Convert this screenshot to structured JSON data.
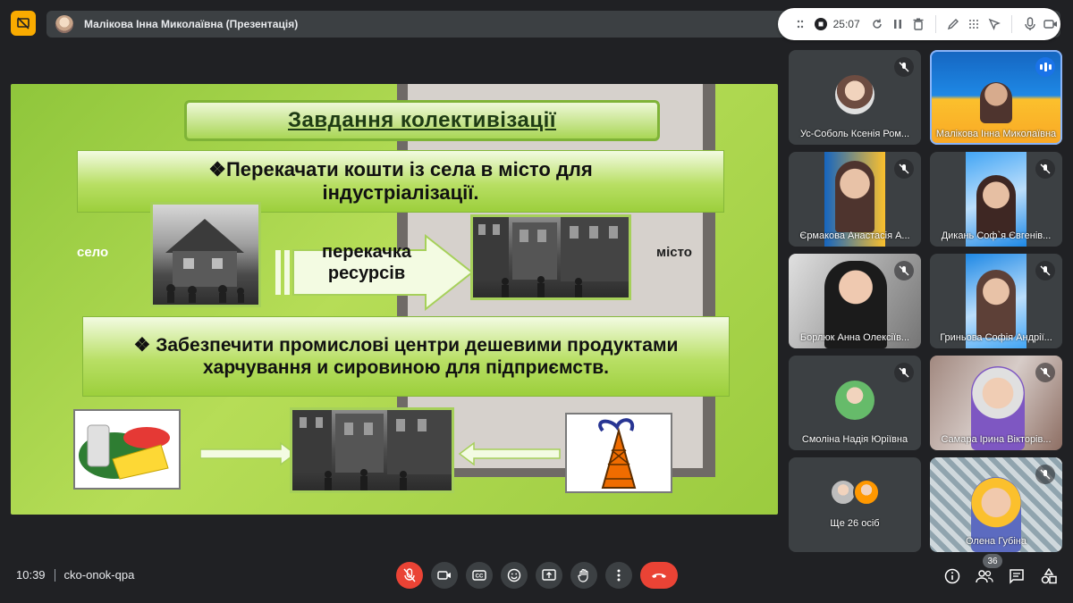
{
  "presenter": {
    "name": "Малікова Інна Миколаївна (Презентація)"
  },
  "recording": {
    "time": "25:07"
  },
  "slide": {
    "title": "Завдання колективізації",
    "bullet1": "❖Перекачати кошти із села в місто для індустріалізації.",
    "bullet2": "❖ Забезпечити промислові центри дешевими продуктами харчування и сировиною для підприємств.",
    "arrow_label": "перекачка ресурсів",
    "label_village": "село",
    "label_city": "місто"
  },
  "participants": [
    {
      "name": "Ус-Соболь Ксенія Ром...",
      "muted": true
    },
    {
      "name": "Малікова Інна Миколаївна",
      "speaking": true
    },
    {
      "name": "Єрмакова Анастасія А...",
      "muted": true
    },
    {
      "name": "Дикань Соф`я Євгенів...",
      "muted": true
    },
    {
      "name": "Борлюк Анна Олексіїв...",
      "muted": true
    },
    {
      "name": "Гриньова Софія Андрії...",
      "muted": true
    },
    {
      "name": "Смоліна Надія Юріївна",
      "muted": true
    },
    {
      "name": "Самара Ірина Вікторів...",
      "muted": true
    },
    {
      "name": "Ще 26 осіб"
    },
    {
      "name": "Олена Губіна",
      "muted": true
    }
  ],
  "meeting": {
    "time": "10:39",
    "code": "cko-onok-qpa",
    "participant_count": "36"
  },
  "colors": {
    "background": "#202124",
    "tile": "#3c4043",
    "accent_red": "#ea4335",
    "present_yellow": "#f9ab00",
    "speaking_blue": "#1a73e8"
  }
}
